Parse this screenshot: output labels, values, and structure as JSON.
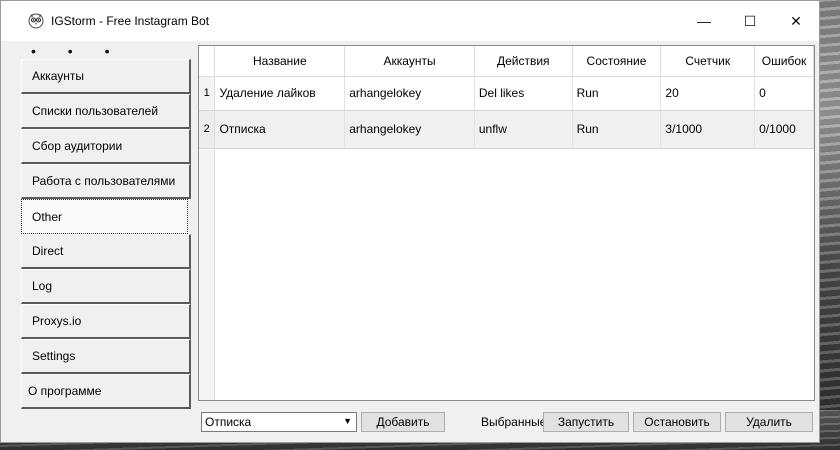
{
  "window": {
    "title": "IGStorm - Free Instagram Bot",
    "minimize_glyph": "—",
    "maximize_glyph": "☐",
    "close_glyph": "✕"
  },
  "dots": "• • •",
  "sidebar": {
    "items": [
      {
        "label": "Аккаунты"
      },
      {
        "label": "Списки пользователей"
      },
      {
        "label": "Сбор аудитории"
      },
      {
        "label": "Работа с пользователями"
      },
      {
        "label": "Other"
      },
      {
        "label": "Direct"
      },
      {
        "label": "Log"
      },
      {
        "label": "Proxys.io"
      },
      {
        "label": "Settings"
      },
      {
        "label": "О программе"
      }
    ],
    "active_index": 4
  },
  "table": {
    "columns": [
      "Название",
      "Аккаунты",
      "Действия",
      "Состояние",
      "Счетчик",
      "Ошибок"
    ],
    "rows": [
      {
        "num": "1",
        "name": "Удаление лайков",
        "accounts": "arhangelokey",
        "action": "Del likes",
        "state": "Run",
        "counter": "20",
        "errors": "0"
      },
      {
        "num": "2",
        "name": "Отписка",
        "accounts": "arhangelokey",
        "action": "unflw",
        "state": "Run",
        "counter": "3/1000",
        "errors": "0/1000"
      }
    ]
  },
  "bottom": {
    "task_select_value": "Отписка",
    "add_label": "Добавить",
    "selected_label": "Выбранные",
    "start_label": "Запустить",
    "stop_label": "Остановить",
    "delete_label": "Удалить"
  },
  "icons": {
    "app": "owl-icon",
    "dropdown": "chevron-down-icon"
  }
}
